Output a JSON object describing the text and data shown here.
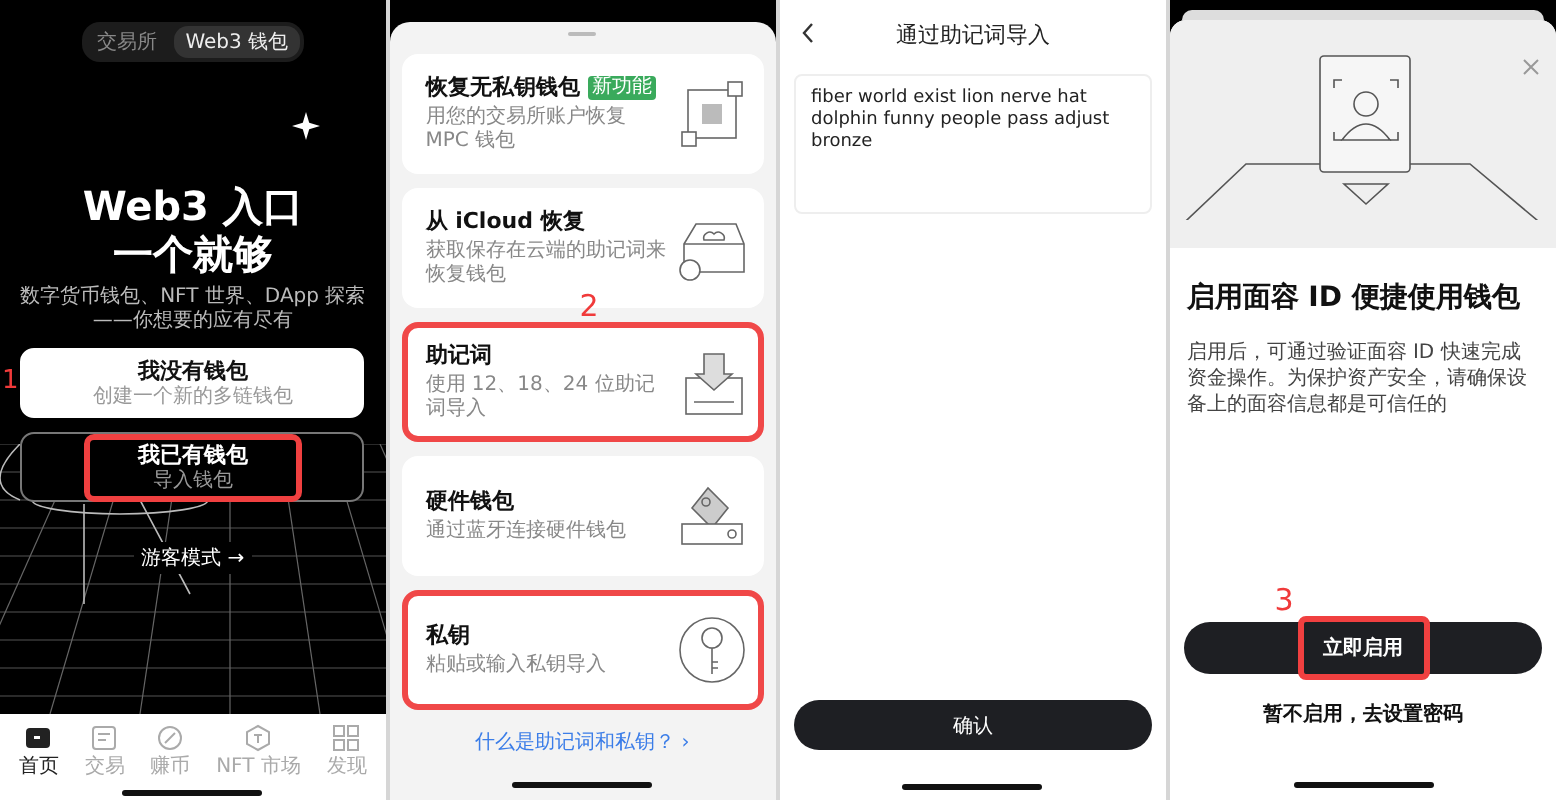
{
  "screens": [
    {
      "kind": "welcome",
      "step": "1",
      "segments": [
        {
          "label": "交易所",
          "selected": false
        },
        {
          "label": "Web3 钱包",
          "selected": true
        }
      ],
      "headline": [
        "Web3 入口",
        "一个就够"
      ],
      "tagline": "数字货币钱包、NFT 世界、DApp 探索——你想要的应有尽有",
      "options": [
        {
          "title": "我没有钱包",
          "subtitle": "创建一个新的多链钱包",
          "kind": "filled",
          "highlighted": false
        },
        {
          "title": "我已有钱包",
          "subtitle": "导入钱包",
          "kind": "outline",
          "highlighted": true
        }
      ],
      "guest_link": "游客模式 →",
      "tabs": [
        {
          "label": "首页",
          "selected": true
        },
        {
          "label": "交易",
          "selected": false
        },
        {
          "label": "赚币",
          "selected": false
        },
        {
          "label": "NFT 市场",
          "selected": false
        },
        {
          "label": "发现",
          "selected": false
        }
      ]
    },
    {
      "kind": "import_methods",
      "step": "2",
      "methods": [
        {
          "title": "恢复无私钥钱包",
          "badge": "新功能",
          "subtitle": "用您的交易所账户恢复 MPC 钱包",
          "highlighted": false
        },
        {
          "title": "从 iCloud 恢复",
          "subtitle": "获取保存在云端的助记词来恢复钱包",
          "highlighted": false
        },
        {
          "title": "助记词",
          "subtitle": "使用 12、18、24 位助记词导入",
          "highlighted": true
        },
        {
          "title": "硬件钱包",
          "subtitle": "通过蓝牙连接硬件钱包",
          "highlighted": false
        },
        {
          "title": "私钥",
          "subtitle": "粘贴或输入私钥导入",
          "highlighted": true
        }
      ],
      "help_link": "什么是助记词和私钥？ ›"
    },
    {
      "kind": "phrase_import",
      "title": "通过助记词导入",
      "phrase": "fiber world exist lion nerve hat dolphin funny people pass adjust bronze",
      "confirm": "确认"
    },
    {
      "kind": "face_id",
      "step": "3",
      "title": "启用面容 ID 便捷使用钱包",
      "description": "启用后，可通过验证面容 ID 快速完成资金操作。为保护资产安全，请确保设备上的面容信息都是可信任的",
      "primary": {
        "label": "立即启用",
        "highlighted": true
      },
      "secondary": "暂不启用，去设置密码"
    }
  ]
}
